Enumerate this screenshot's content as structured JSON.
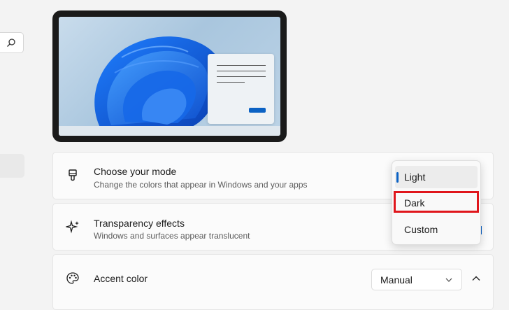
{
  "sidebar": {
    "search_icon": "search-icon"
  },
  "preview": {
    "description_icon": "wallpaper-preview"
  },
  "mode_card": {
    "icon": "paintbrush-icon",
    "title": "Choose your mode",
    "description": "Change the colors that appear in Windows and your apps"
  },
  "transparency_card": {
    "icon": "sparkle-icon",
    "title": "Transparency effects",
    "description": "Windows and surfaces appear translucent",
    "toggle_on": true
  },
  "accent_card": {
    "icon": "palette-icon",
    "title": "Accent color",
    "selected": "Manual"
  },
  "mode_menu": {
    "options": [
      "Light",
      "Dark",
      "Custom"
    ],
    "selected": "Light",
    "highlighted": "Dark"
  },
  "colors": {
    "accent": "#0b62c4",
    "highlight": "#e0161c"
  }
}
